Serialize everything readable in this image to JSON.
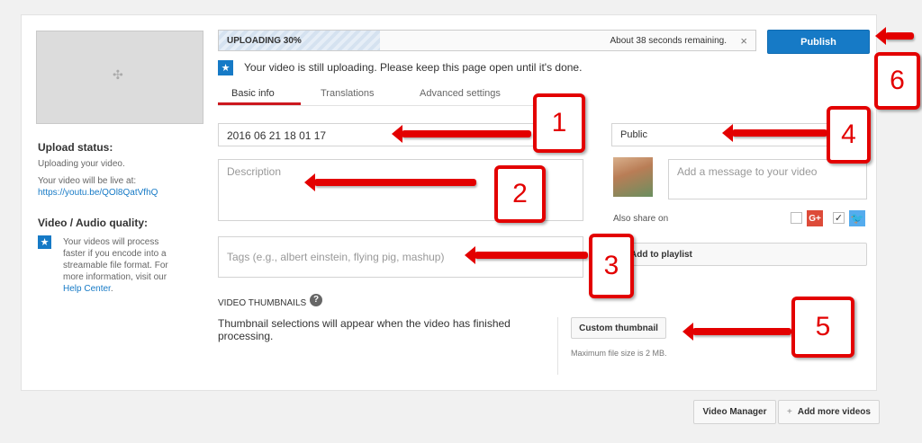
{
  "left": {
    "upload_status_title": "Upload status:",
    "upload_status_text": "Uploading your video.",
    "live_at_text": "Your video will be live at:",
    "video_url": "https://youtu.be/QOl8QatVfhQ",
    "quality_title": "Video / Audio quality:",
    "quality_text": "Your videos will process faster if you encode into a streamable file format. For more information, visit our",
    "help_link": "Help Center",
    "help_period": "."
  },
  "progress": {
    "label": "UPLOADING 30%",
    "percent": 30,
    "remaining": "About 38 seconds remaining.",
    "close": "×"
  },
  "publish_label": "Publish",
  "notice": "Your video is still uploading. Please keep this page open until it's done.",
  "tabs": [
    {
      "label": "Basic info"
    },
    {
      "label": "Translations"
    },
    {
      "label": "Advanced settings"
    }
  ],
  "form": {
    "title_value": "2016 06 21 18 01 17",
    "description_placeholder": "Description",
    "tags_placeholder": "Tags (e.g., albert einstein, flying pig, mashup)"
  },
  "privacy_value": "Public",
  "message_placeholder": "Add a message to your video",
  "also_share": "Also share on",
  "gplus_label": "G+",
  "twitter_glyph": "🐦",
  "playlist_label": "Add to playlist",
  "thumbnails": {
    "title": "VIDEO THUMBNAILS",
    "help": "?",
    "text": "Thumbnail selections will appear when the video has finished processing.",
    "custom_button": "Custom thumbnail",
    "max_size": "Maximum file size is 2 MB."
  },
  "footer": {
    "video_manager": "Video Manager",
    "add_more": "Add more videos",
    "plus": "+"
  },
  "annotations": [
    "1",
    "2",
    "3",
    "4",
    "5",
    "6"
  ],
  "colors": {
    "accent": "#167ac6",
    "annotation": "#e30000"
  }
}
